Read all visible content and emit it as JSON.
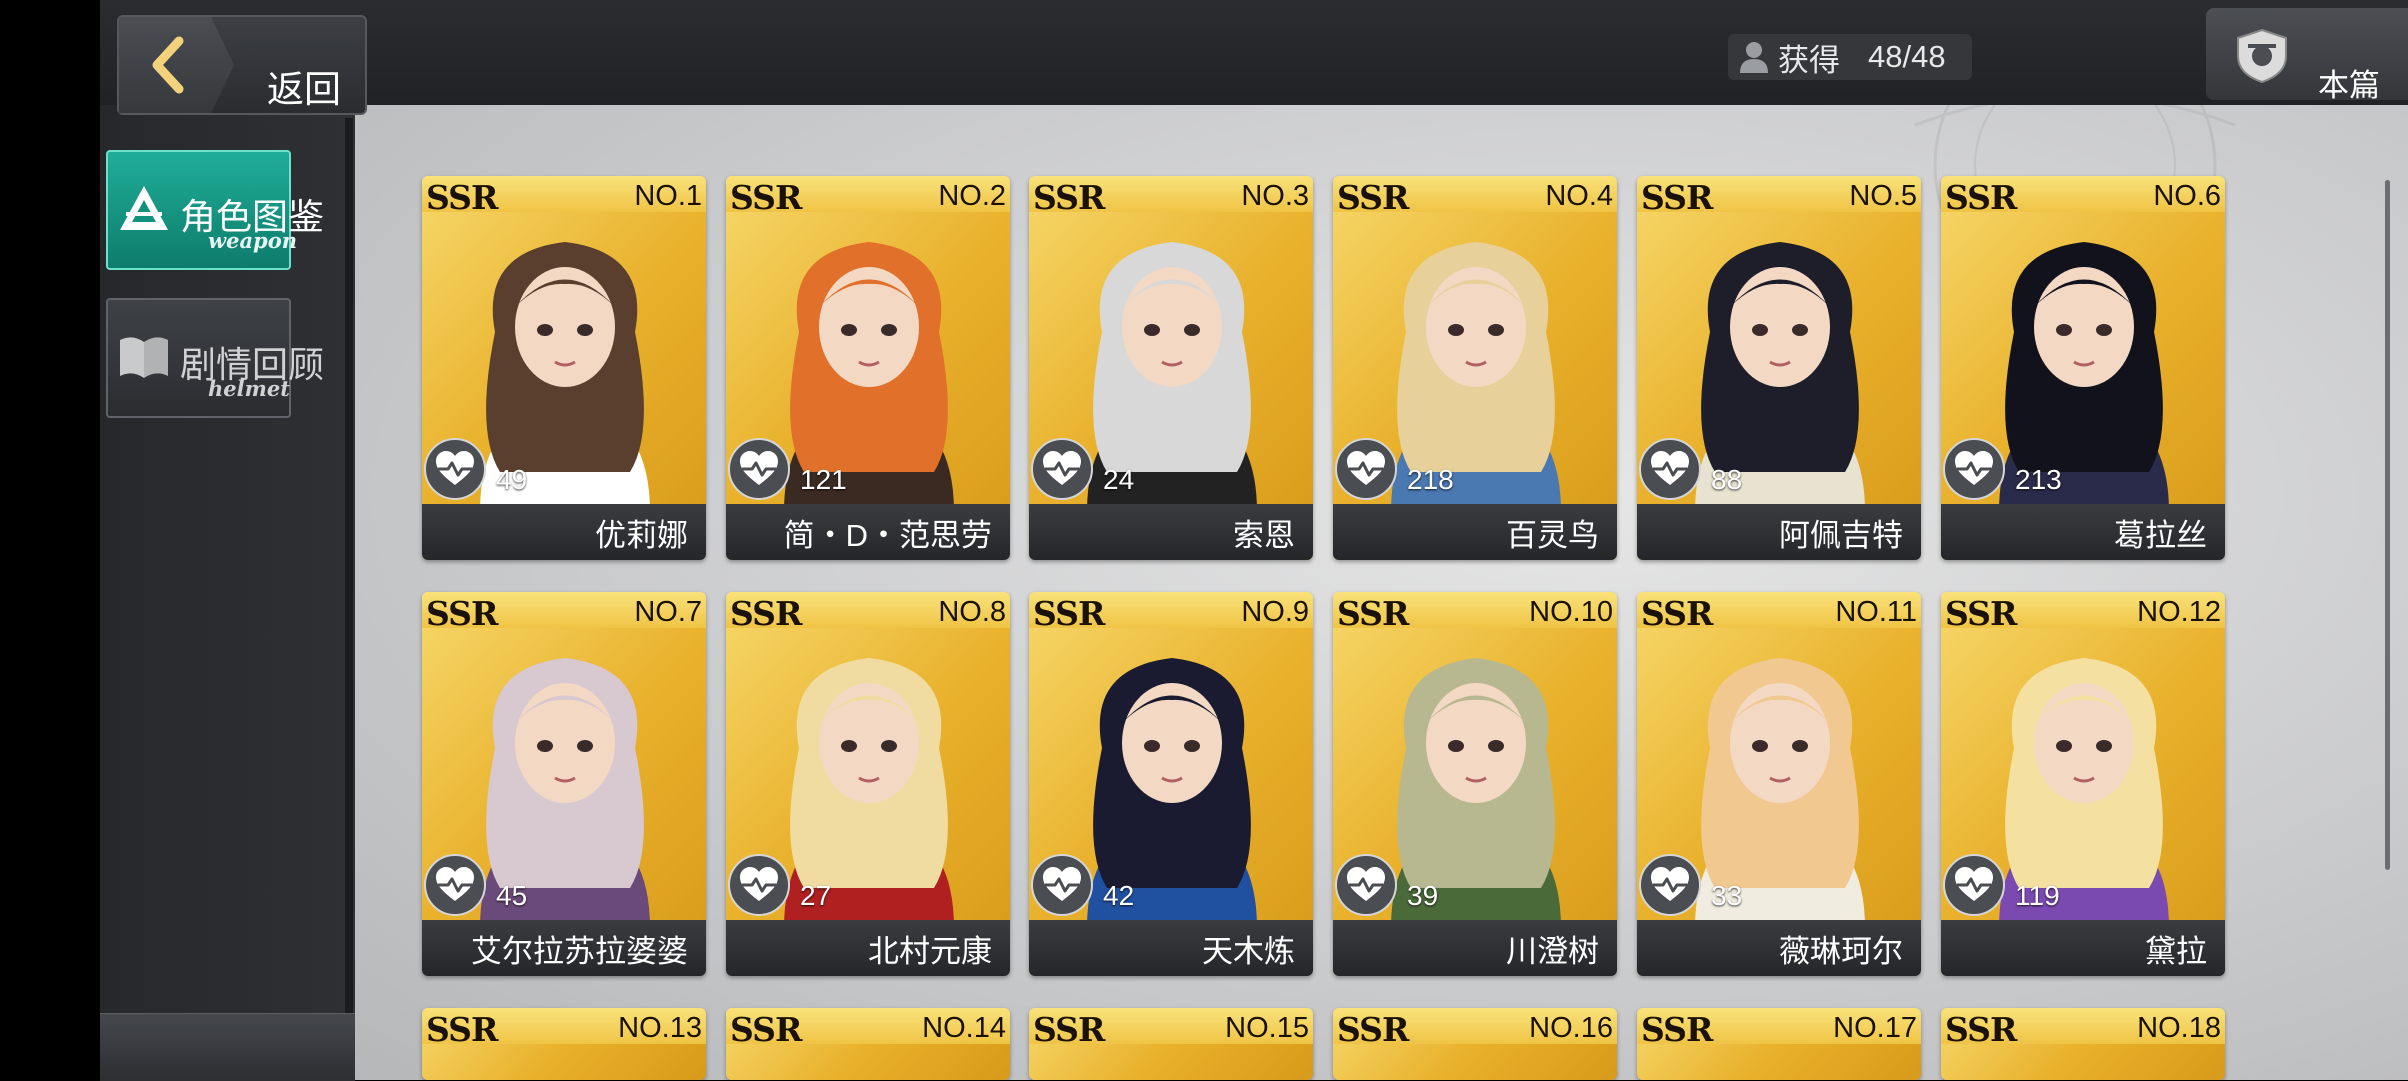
{
  "header": {
    "back_label": "返回",
    "acquired_label": "获得",
    "acquired_count": "48/48",
    "chapter_label": "本篇"
  },
  "sidebar": {
    "tabs": [
      {
        "label": "角色图鉴",
        "sub": "weapon",
        "active": true,
        "icon": "triangle-icon"
      },
      {
        "label": "剧情回顾",
        "sub": "helmet",
        "active": false,
        "icon": "book-icon"
      }
    ]
  },
  "colors": {
    "active_tab": "#1fae98",
    "card_gold": "#e9b12c",
    "name_bar": "#2e3034"
  },
  "cards": [
    {
      "rarity": "SSR",
      "no": "NO.1",
      "likes": "49",
      "name": "优莉娜",
      "hair": "#5a3e2e",
      "cloth": "#ffffff"
    },
    {
      "rarity": "SSR",
      "no": "NO.2",
      "likes": "121",
      "name": "简・D・范思劳",
      "hair": "#e0702a",
      "cloth": "#3a2a22"
    },
    {
      "rarity": "SSR",
      "no": "NO.3",
      "likes": "24",
      "name": "索恩",
      "hair": "#d8d8d8",
      "cloth": "#222222"
    },
    {
      "rarity": "SSR",
      "no": "NO.4",
      "likes": "218",
      "name": "百灵鸟",
      "hair": "#e8d09a",
      "cloth": "#4a78b0"
    },
    {
      "rarity": "SSR",
      "no": "NO.5",
      "likes": "88",
      "name": "阿佩吉特",
      "hair": "#1e1e2a",
      "cloth": "#e8e2d0"
    },
    {
      "rarity": "SSR",
      "no": "NO.6",
      "likes": "213",
      "name": "葛拉丝",
      "hair": "#12121c",
      "cloth": "#2a2a4a"
    },
    {
      "rarity": "SSR",
      "no": "NO.7",
      "likes": "45",
      "name": "艾尔拉苏拉婆婆",
      "hair": "#d8c8d0",
      "cloth": "#6a4a7a"
    },
    {
      "rarity": "SSR",
      "no": "NO.8",
      "likes": "27",
      "name": "北村元康",
      "hair": "#f0dca0",
      "cloth": "#b02020"
    },
    {
      "rarity": "SSR",
      "no": "NO.9",
      "likes": "42",
      "name": "天木炼",
      "hair": "#1a1a30",
      "cloth": "#2050a0"
    },
    {
      "rarity": "SSR",
      "no": "NO.10",
      "likes": "39",
      "name": "川澄树",
      "hair": "#b8b890",
      "cloth": "#4a6a3a"
    },
    {
      "rarity": "SSR",
      "no": "NO.11",
      "likes": "33",
      "name": "薇琳珂尔",
      "hair": "#f0c890",
      "cloth": "#f0ece0"
    },
    {
      "rarity": "SSR",
      "no": "NO.12",
      "likes": "119",
      "name": "黛拉",
      "hair": "#f4e0a0",
      "cloth": "#7a4ab0"
    }
  ],
  "partial_cards": [
    {
      "rarity": "SSR",
      "no": "NO.13"
    },
    {
      "rarity": "SSR",
      "no": "NO.14"
    },
    {
      "rarity": "SSR",
      "no": "NO.15"
    },
    {
      "rarity": "SSR",
      "no": "NO.16"
    },
    {
      "rarity": "SSR",
      "no": "NO.17"
    },
    {
      "rarity": "SSR",
      "no": "NO.18"
    }
  ]
}
